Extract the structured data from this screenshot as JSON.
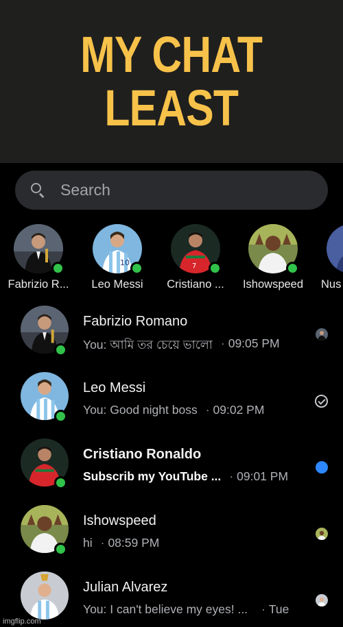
{
  "caption": {
    "line1": "MY CHAT",
    "line2": "LEAST"
  },
  "search": {
    "placeholder": "Search"
  },
  "stories": [
    {
      "label": "Fabrizio R...",
      "online": true
    },
    {
      "label": "Leo Messi",
      "online": true
    },
    {
      "label": "Cristiano ...",
      "online": true
    },
    {
      "label": "Ishowspeed",
      "online": true
    },
    {
      "label": "Nus",
      "online": false
    }
  ],
  "chats": [
    {
      "name": "Fabrizio Romano",
      "message": "You: আমি তর চেয়ে ভালো",
      "separator": "·",
      "time": "09:05 PM",
      "status": "seen-avatar",
      "unread": false
    },
    {
      "name": "Leo Messi",
      "message": "You: Good night boss",
      "separator": "·",
      "time": "09:02 PM",
      "status": "sent-check",
      "unread": false
    },
    {
      "name": "Cristiano Ronaldo",
      "message": "Subscrib my YouTube ...",
      "separator": "·",
      "time": "09:01 PM",
      "status": "unread-dot",
      "unread": true
    },
    {
      "name": "Ishowspeed",
      "message": "hi",
      "separator": "·",
      "time": "08:59 PM",
      "status": "seen-avatar",
      "unread": false
    },
    {
      "name": "Julian Alvarez",
      "message": "You: I can't believe my eyes! ...",
      "separator": "·",
      "time": "Tue",
      "status": "seen-avatar",
      "unread": false
    }
  ],
  "colors": {
    "caption_text": "#f7c24a",
    "caption_bg": "#1f1f1e",
    "online": "#31c24a",
    "unread": "#2d88ff",
    "search_bg": "#2a2b2e"
  },
  "watermark": "imgflip.com"
}
